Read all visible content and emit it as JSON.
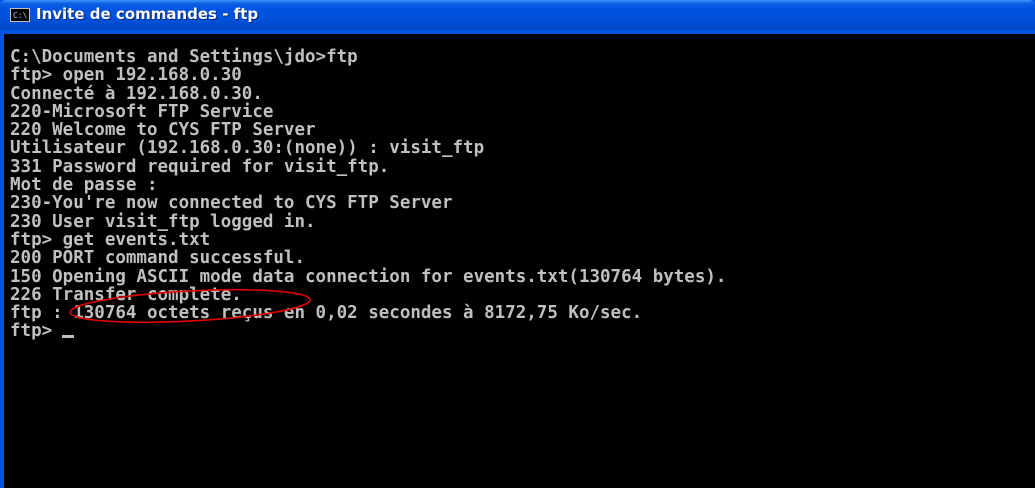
{
  "window": {
    "title": "Invite de commandes - ftp",
    "icon": "cmd-console-icon",
    "icon_text": "C:\\"
  },
  "console": {
    "lines": [
      "C:\\Documents and Settings\\jdo>ftp",
      "ftp> open 192.168.0.30",
      "Connecté à 192.168.0.30.",
      "220-Microsoft FTP Service",
      "220 Welcome to CYS FTP Server",
      "Utilisateur (192.168.0.30:(none)) : visit_ftp",
      "331 Password required for visit_ftp.",
      "Mot de passe :",
      "230-You're now connected to CYS FTP Server",
      "230 User visit_ftp logged in.",
      "ftp> get events.txt",
      "200 PORT command successful.",
      "150 Opening ASCII mode data connection for events.txt(130764 bytes).",
      "226 Transfer complete.",
      "ftp : 130764 octets reçus en 0,02 secondes à 8172,75 Ko/sec.",
      "ftp>"
    ]
  },
  "colors": {
    "titlebar": "#0054e3",
    "console_bg": "#000000",
    "console_text": "#c0c0c0",
    "annotation": "#e00000"
  }
}
